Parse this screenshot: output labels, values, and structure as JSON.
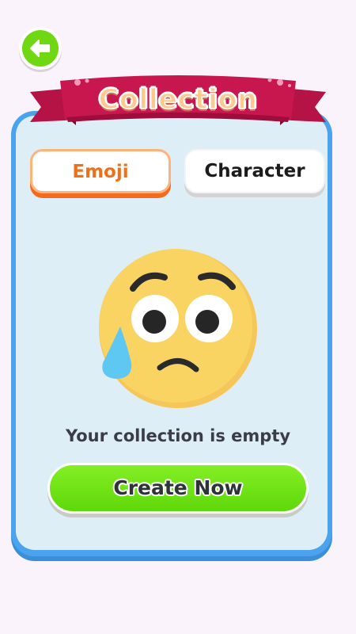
{
  "header": {
    "back_icon": "arrow-left-icon",
    "title": "Collection"
  },
  "tabs": [
    {
      "label": "Emoji",
      "active": true
    },
    {
      "label": "Character",
      "active": false
    }
  ],
  "empty_state": {
    "icon": "sad-tear-emoji-icon",
    "message": "Your collection is empty"
  },
  "actions": {
    "create_label": "Create Now"
  },
  "colors": {
    "background": "#faf3fb",
    "panel_border": "#4aa3ee",
    "panel_fill": "#deeef6",
    "ribbon": "#c8174f",
    "title_fill": "#ffc98c",
    "active_tab_text": "#f07018",
    "active_tab_underline": "#f46a1e",
    "create_button": "#6ee012",
    "back_button": "#6fd812",
    "emoji_face": "#f9d463",
    "tear": "#5ec8f2"
  }
}
